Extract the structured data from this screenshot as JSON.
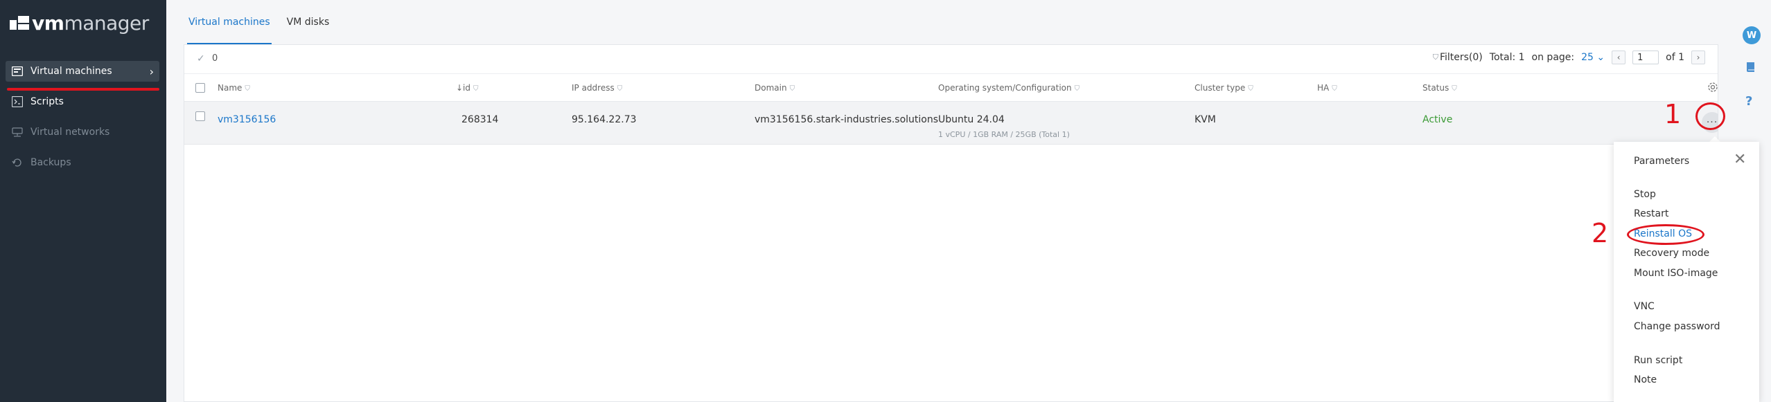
{
  "app": {
    "logo_bold": "vm",
    "logo_light": "manager"
  },
  "sidebar": {
    "items": [
      {
        "label": "Virtual machines",
        "icon": "vm-icon",
        "state": "active"
      },
      {
        "label": "Scripts",
        "icon": "scripts-icon",
        "state": "normal"
      },
      {
        "label": "Virtual networks",
        "icon": "network-icon",
        "state": "disabled"
      },
      {
        "label": "Backups",
        "icon": "backup-icon",
        "state": "disabled"
      }
    ]
  },
  "tabs": [
    {
      "label": "Virtual machines",
      "active": true
    },
    {
      "label": "VM disks",
      "active": false
    }
  ],
  "toolbar": {
    "selected_count": "0",
    "filters_label": "Filters(0)",
    "total_label": "Total: 1",
    "on_page_label": "on page:",
    "per_page": "25",
    "page_value": "1",
    "of_label": "of 1"
  },
  "table": {
    "columns": [
      "Name",
      "↓id",
      "IP address",
      "Domain",
      "Operating system/Configuration",
      "Cluster type",
      "HA",
      "Status"
    ],
    "rows": [
      {
        "name": "vm3156156",
        "id": "268314",
        "ip": "95.164.22.73",
        "domain": "vm3156156.stark-industries.solutions",
        "os": "Ubuntu 24.04",
        "config": "1 vCPU / 1GB RAM / 25GB (Total 1)",
        "cluster": "KVM",
        "ha": "",
        "status": "Active"
      }
    ]
  },
  "menu": {
    "title": "Parameters",
    "items": [
      "Stop",
      "Restart",
      "Reinstall OS",
      "Recovery mode",
      "Mount ISO-image",
      "VNC",
      "Change password",
      "Run script",
      "Note"
    ],
    "highlighted": "Reinstall OS"
  },
  "rail": {
    "avatar_letter": "W",
    "icons": [
      "book-icon",
      "help-icon"
    ]
  },
  "annotations": {
    "step1": "1",
    "step2": "2",
    "color": "#e0141e"
  },
  "colors": {
    "accent": "#1a76c9",
    "sidebar_bg": "#232d38",
    "status_active": "#3b9a35"
  }
}
